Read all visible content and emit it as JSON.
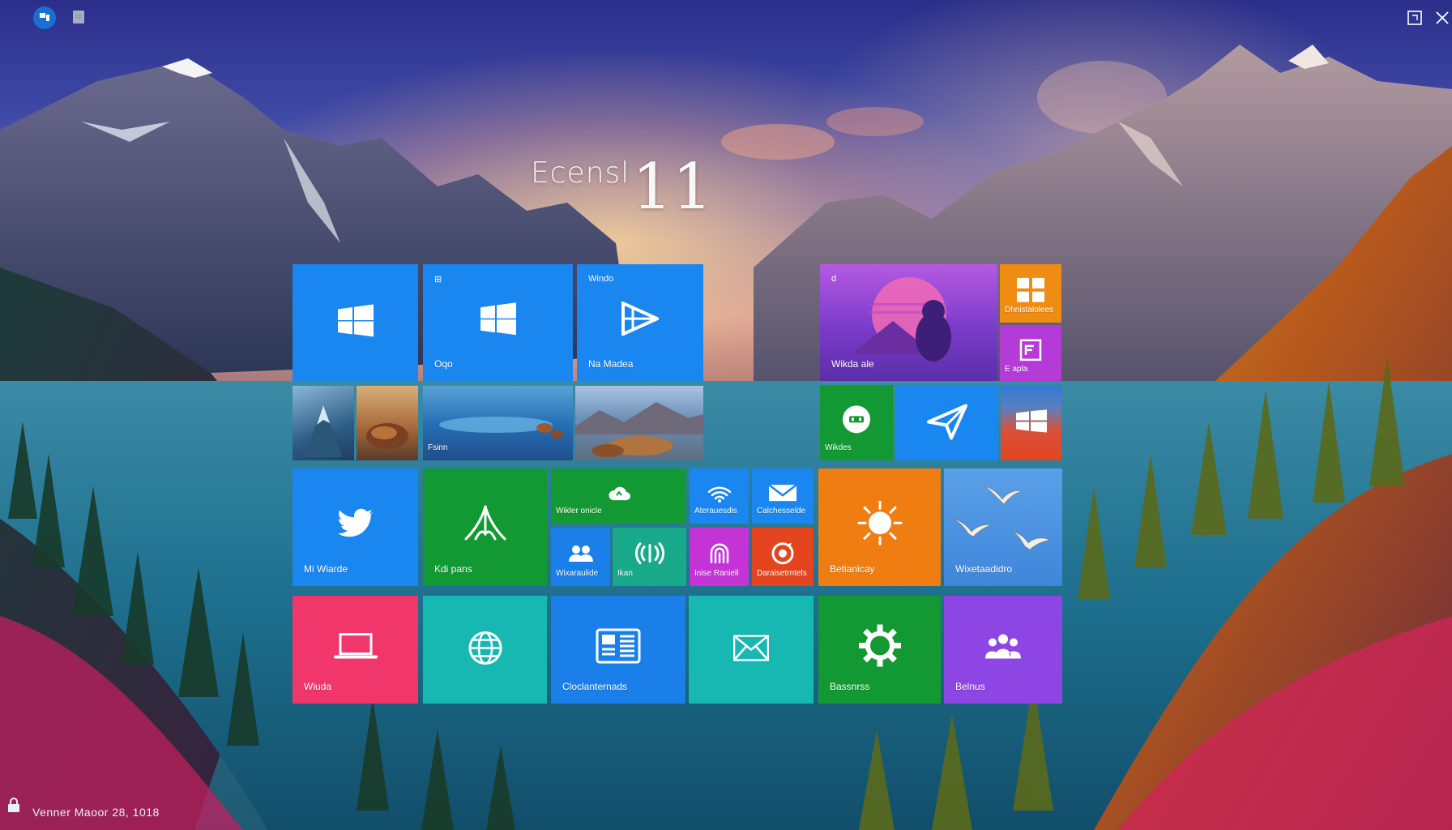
{
  "title": {
    "left": "Ecensl",
    "right": "11"
  },
  "top_bar": {
    "left_icons": [
      "app-icon",
      "window-icon"
    ],
    "right_icons": [
      "restore-icon",
      "close-icon"
    ]
  },
  "tiles": {
    "windows_blue": {
      "label": ""
    },
    "store": {
      "corner": "⊞",
      "label": "Oqo"
    },
    "media": {
      "corner": "Windo",
      "label": "Na Madea"
    },
    "photo_purple": {
      "corner": "d",
      "label": "Wikda ale"
    },
    "small_orange": {
      "label": "Dhnistalolees"
    },
    "small_magenta": {
      "label": "E apla"
    },
    "photos_row": {
      "label": "Fsinn"
    },
    "xbox": {
      "label": "Wikdes"
    },
    "plane": {
      "label": ""
    },
    "windows_red": {
      "label": ""
    },
    "twitter": {
      "label": "Mi Wiarde"
    },
    "maps": {
      "label": "Kdi pans"
    },
    "onedrive": {
      "label": "Wikler onicle"
    },
    "wifi": {
      "label": "Aterauesdis"
    },
    "mail_small": {
      "label": "Calchesselde"
    },
    "people_small": {
      "label": "Wixaraulide"
    },
    "sound": {
      "label": "Ikan"
    },
    "fingerprint": {
      "label": "Inise Raniell"
    },
    "target": {
      "label": "Daraisetrntels"
    },
    "weather": {
      "label": "Betianicay"
    },
    "birds": {
      "label": "Wixetaadidro"
    },
    "laptop": {
      "label": "Wiuda"
    },
    "globe": {
      "label": ""
    },
    "news": {
      "label": "Cloclanternads"
    },
    "mail": {
      "label": ""
    },
    "settings": {
      "label": "Bassnrss"
    },
    "people": {
      "label": "Belnus"
    }
  },
  "status_bar": {
    "text": "Venner Maoor 28, 1018"
  },
  "colors": {
    "blue": "#1a86f0",
    "green": "#139933",
    "teal": "#18b8b2",
    "orange": "#ef7d12",
    "purple": "#8d45e3",
    "pink": "#f0366a",
    "magenta": "#c433d6",
    "red": "#e4451f"
  }
}
